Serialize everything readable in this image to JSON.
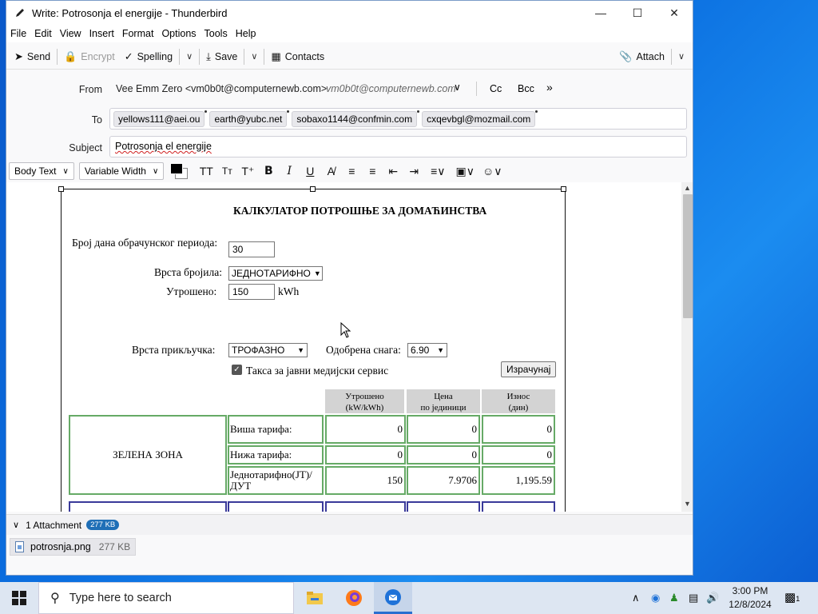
{
  "window": {
    "title": "Write: Potrosonja el energije - Thunderbird"
  },
  "menu": [
    "File",
    "Edit",
    "View",
    "Insert",
    "Format",
    "Options",
    "Tools",
    "Help"
  ],
  "toolbar": {
    "send": "Send",
    "encrypt": "Encrypt",
    "spelling": "Spelling",
    "save": "Save",
    "contacts": "Contacts",
    "attach": "Attach"
  },
  "header": {
    "from_label": "From",
    "from_value": "Vee Emm Zero <vm0b0t@computernewb.com>",
    "from_alias": "vm0b0t@computernewb.com",
    "cc": "Cc",
    "bcc": "Bcc",
    "to_label": "To",
    "recipients": [
      "yellows111@aei.ou",
      "earth@yubc.net",
      "sobaxo1144@confmin.com",
      "cxqevbgl@mozmail.com"
    ],
    "subject_label": "Subject",
    "subject_value": "Potrosonja el energije"
  },
  "format": {
    "paragraph_style": "Body Text",
    "font": "Variable Width",
    "text_color": "#000000"
  },
  "calculator": {
    "title": "КАЛКУЛАТОР ПОТРОШЊЕ ЗА ДОМАЋИНСТВА",
    "days_label": "Број дана обрачунског периода:",
    "days_value": "30",
    "meter_label": "Врста бројила:",
    "meter_value": "ЈЕДНОТАРИФНО",
    "consumed_label": "Утрошено:",
    "consumed_value": "150",
    "consumed_unit": "kWh",
    "connection_label": "Врста прикључка:",
    "connection_value": "ТРОФАЗНО",
    "power_label": "Одобрена снага:",
    "power_value": "6.90",
    "tax_label": "Такса за јавни медијски сервис",
    "tax_checked": true,
    "calc_button": "Израчунај",
    "col_headers": [
      [
        "Утрошено",
        "(kW/kWh)"
      ],
      [
        "Цена",
        "по јединици"
      ],
      [
        "Износ",
        "(дин)"
      ]
    ],
    "zone_label": "ЗЕЛЕНА ЗОНА",
    "rows": [
      {
        "label": "Виша тарифа:",
        "consumed": "0",
        "price": "0",
        "amount": "0"
      },
      {
        "label": "Нижа тарифа:",
        "consumed": "0",
        "price": "0",
        "amount": "0"
      },
      {
        "label": "Једнотарифно(ЈТ)/ДУТ",
        "consumed": "150",
        "price": "7.9706",
        "amount": "1,195.59"
      }
    ]
  },
  "attachments": {
    "summary": "1 Attachment",
    "total_size": "277 KB",
    "items": [
      {
        "name": "potrosnja.png",
        "size": "277 KB"
      }
    ]
  },
  "taskbar": {
    "search_placeholder": "Type here to search",
    "time": "3:00 PM",
    "date": "12/8/2024",
    "notification_count": "1"
  }
}
